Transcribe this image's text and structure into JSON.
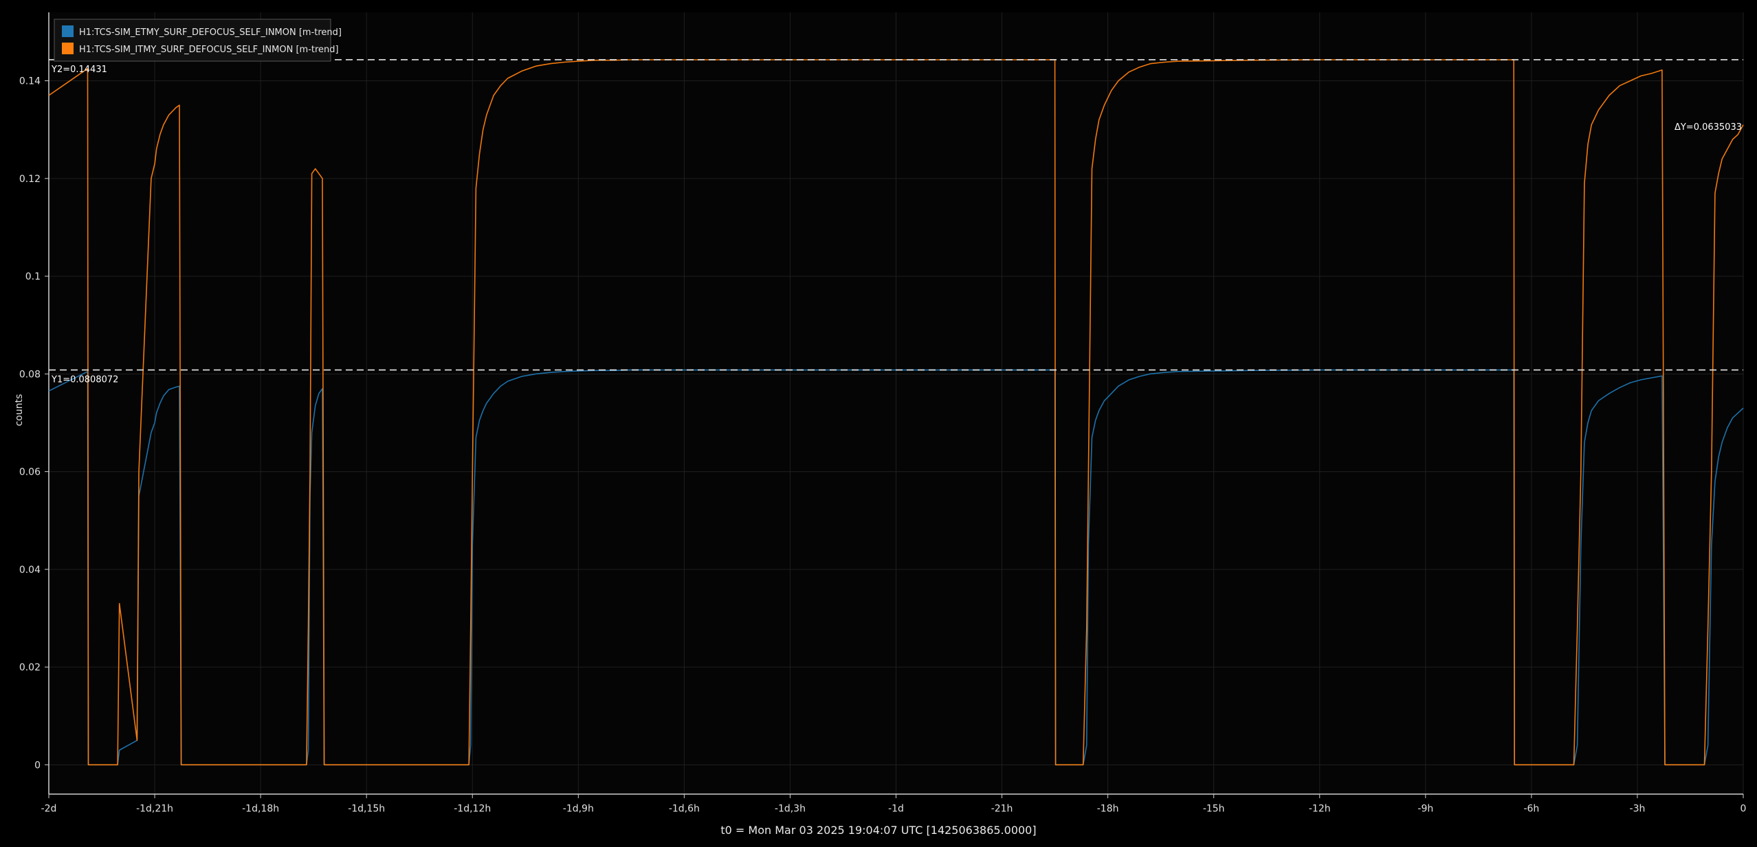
{
  "chart_data": {
    "type": "line",
    "ylabel": "counts",
    "xlabel": "",
    "footer": "t0 = Mon Mar 03 2025 19:04:07 UTC [1425063865.0000]",
    "xlim_hours": [
      -48,
      0
    ],
    "ylim": [
      -0.006,
      0.154
    ],
    "grid": true,
    "legend_position": "top-left",
    "x_ticks": [
      {
        "v": -48,
        "label": "-2d"
      },
      {
        "v": -45,
        "label": "-1d,21h"
      },
      {
        "v": -42,
        "label": "-1d,18h"
      },
      {
        "v": -39,
        "label": "-1d,15h"
      },
      {
        "v": -36,
        "label": "-1d,12h"
      },
      {
        "v": -33,
        "label": "-1d,9h"
      },
      {
        "v": -30,
        "label": "-1d,6h"
      },
      {
        "v": -27,
        "label": "-1d,3h"
      },
      {
        "v": -24,
        "label": "-1d"
      },
      {
        "v": -21,
        "label": "-21h"
      },
      {
        "v": -18,
        "label": "-18h"
      },
      {
        "v": -15,
        "label": "-15h"
      },
      {
        "v": -12,
        "label": "-12h"
      },
      {
        "v": -9,
        "label": "-9h"
      },
      {
        "v": -6,
        "label": "-6h"
      },
      {
        "v": -3,
        "label": "-3h"
      },
      {
        "v": 0,
        "label": "0"
      }
    ],
    "y_ticks": [
      {
        "v": 0,
        "label": "0"
      },
      {
        "v": 0.02,
        "label": "0.02"
      },
      {
        "v": 0.04,
        "label": "0.04"
      },
      {
        "v": 0.06,
        "label": "0.06"
      },
      {
        "v": 0.08,
        "label": "0.08"
      },
      {
        "v": 0.1,
        "label": "0.1"
      },
      {
        "v": 0.12,
        "label": "0.12"
      },
      {
        "v": 0.14,
        "label": "0.14"
      }
    ],
    "cursors": {
      "y1": 0.0808072,
      "y1_label": "Y1=0.0808072",
      "y2": 0.14431,
      "y2_label": "Y2=0.14431",
      "dy_label": "ΔY=0.0635033"
    },
    "series": [
      {
        "name": "H1:TCS-SIM_ETMY_SURF_DEFOCUS_SELF_INMON [m-trend]",
        "color": "#1f77b4",
        "x": [
          -48,
          -46.9,
          -46.88,
          -46.05,
          -46,
          -45.5,
          -45.45,
          -45.1,
          -45.0,
          -44.95,
          -44.85,
          -44.75,
          -44.6,
          -44.4,
          -44.3,
          -44.25,
          -40.7,
          -40.65,
          -40.6,
          -40.55,
          -40.45,
          -40.35,
          -40.25,
          -40.2,
          -36.1,
          -36.05,
          -36.0,
          -35.9,
          -35.8,
          -35.7,
          -35.6,
          -35.4,
          -35.2,
          -35.0,
          -34.6,
          -34.2,
          -33.8,
          -33.4,
          -33.0,
          -32.5,
          -32.0,
          -31.5,
          -31.0,
          -30.0,
          -28.0,
          -26.0,
          -24.0,
          -22.0,
          -20.0,
          -19.5,
          -19.48,
          -18.7,
          -18.6,
          -18.55,
          -18.45,
          -18.35,
          -18.25,
          -18.1,
          -17.9,
          -17.7,
          -17.4,
          -17.1,
          -16.8,
          -16.4,
          -16.0,
          -15.0,
          -14.0,
          -12.0,
          -10.0,
          -8.0,
          -6.5,
          -6.48,
          -4.8,
          -4.7,
          -4.6,
          -4.5,
          -4.4,
          -4.3,
          -4.1,
          -3.8,
          -3.5,
          -3.2,
          -2.9,
          -2.6,
          -2.3,
          -2.22,
          -1.1,
          -1.0,
          -0.9,
          -0.8,
          -0.7,
          -0.6,
          -0.45,
          -0.3,
          -0.15,
          0
        ],
        "y": [
          0.0765,
          0.0805,
          0,
          0,
          0.003,
          0.005,
          0.055,
          0.068,
          0.07,
          0.072,
          0.074,
          0.0755,
          0.0768,
          0.0773,
          0.0775,
          0,
          0,
          0.003,
          0.055,
          0.068,
          0.0735,
          0.076,
          0.077,
          0,
          0,
          0.004,
          0.045,
          0.067,
          0.0705,
          0.0725,
          0.074,
          0.076,
          0.0775,
          0.0785,
          0.0795,
          0.08,
          0.0803,
          0.0805,
          0.0806,
          0.0807,
          0.0807,
          0.0808,
          0.0808,
          0.0808,
          0.0808,
          0.0808,
          0.0808,
          0.0808,
          0.0808,
          0.0808,
          0,
          0,
          0.004,
          0.045,
          0.067,
          0.0705,
          0.0725,
          0.0745,
          0.076,
          0.0775,
          0.0788,
          0.0795,
          0.08,
          0.0803,
          0.0805,
          0.0806,
          0.0807,
          0.0808,
          0.0808,
          0.0808,
          0.0808,
          0,
          0,
          0.004,
          0.045,
          0.066,
          0.07,
          0.0725,
          0.0745,
          0.076,
          0.0772,
          0.0782,
          0.0788,
          0.0792,
          0.0796,
          0,
          0,
          0.004,
          0.045,
          0.058,
          0.063,
          0.066,
          0.069,
          0.071,
          0.072,
          0.073
        ]
      },
      {
        "name": "H1:TCS-SIM_ITMY_SURF_DEFOCUS_SELF_INMON [m-trend]",
        "color": "#ff7f0e",
        "x": [
          -48,
          -46.9,
          -46.88,
          -46.05,
          -46,
          -45.5,
          -45.45,
          -45.1,
          -45.0,
          -44.95,
          -44.85,
          -44.75,
          -44.6,
          -44.4,
          -44.3,
          -44.25,
          -40.7,
          -40.65,
          -40.6,
          -40.55,
          -40.45,
          -40.35,
          -40.25,
          -40.2,
          -36.1,
          -36.05,
          -36.0,
          -35.9,
          -35.8,
          -35.7,
          -35.6,
          -35.4,
          -35.2,
          -35.0,
          -34.6,
          -34.2,
          -33.8,
          -33.4,
          -33.0,
          -32.5,
          -32.0,
          -31.5,
          -31.0,
          -30.0,
          -28.0,
          -26.0,
          -24.0,
          -22.0,
          -20.0,
          -19.5,
          -19.48,
          -18.7,
          -18.6,
          -18.55,
          -18.45,
          -18.35,
          -18.25,
          -18.1,
          -17.9,
          -17.7,
          -17.4,
          -17.1,
          -16.8,
          -16.4,
          -16.0,
          -15.0,
          -14.0,
          -12.0,
          -10.0,
          -8.0,
          -6.5,
          -6.48,
          -4.8,
          -4.7,
          -4.6,
          -4.5,
          -4.4,
          -4.3,
          -4.1,
          -3.8,
          -3.5,
          -3.2,
          -2.9,
          -2.6,
          -2.3,
          -2.22,
          -1.1,
          -1.0,
          -0.9,
          -0.8,
          -0.7,
          -0.6,
          -0.45,
          -0.3,
          -0.15,
          0
        ],
        "y": [
          0.137,
          0.1425,
          0,
          0,
          0.033,
          0.005,
          0.06,
          0.12,
          0.123,
          0.126,
          0.129,
          0.131,
          0.133,
          0.1345,
          0.135,
          0,
          0,
          0.028,
          0.06,
          0.121,
          0.122,
          0.121,
          0.12,
          0,
          0,
          0.028,
          0.06,
          0.118,
          0.125,
          0.13,
          0.133,
          0.137,
          0.139,
          0.1405,
          0.142,
          0.143,
          0.1435,
          0.1438,
          0.144,
          0.1442,
          0.1442,
          0.1443,
          0.1443,
          0.1443,
          0.1443,
          0.1443,
          0.1443,
          0.1443,
          0.1443,
          0.1443,
          0,
          0,
          0.028,
          0.06,
          0.122,
          0.128,
          0.132,
          0.135,
          0.138,
          0.14,
          0.1418,
          0.1428,
          0.1435,
          0.1438,
          0.144,
          0.1441,
          0.1442,
          0.1443,
          0.1443,
          0.1443,
          0.1443,
          0,
          0,
          0.028,
          0.06,
          0.119,
          0.127,
          0.131,
          0.134,
          0.137,
          0.139,
          0.14,
          0.141,
          0.1415,
          0.1422,
          0,
          0,
          0.028,
          0.06,
          0.117,
          0.121,
          0.124,
          0.126,
          0.128,
          0.129,
          0.131
        ]
      }
    ]
  }
}
